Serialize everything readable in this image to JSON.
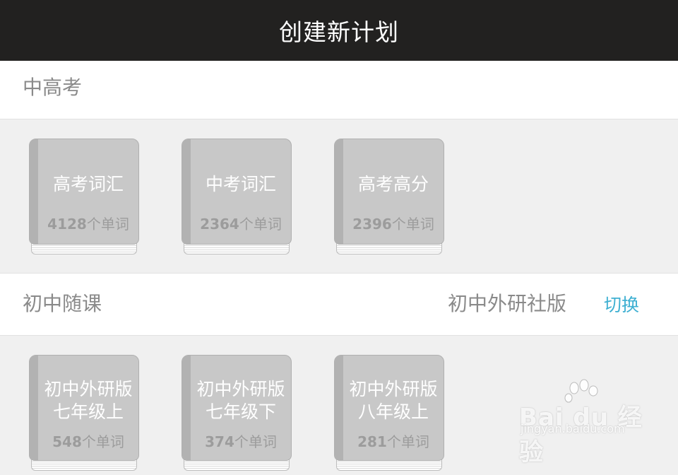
{
  "header": {
    "title": "创建新计划"
  },
  "sections": [
    {
      "label": "中高考",
      "books": [
        {
          "name_line1": "高考词汇",
          "count": "4128",
          "unit": "个单词"
        },
        {
          "name_line1": "中考词汇",
          "count": "2364",
          "unit": "个单词"
        },
        {
          "name_line1": "高考高分",
          "count": "2396",
          "unit": "个单词"
        }
      ]
    },
    {
      "label": "初中随课",
      "edition": "初中外研社版",
      "switch_label": "切换",
      "books": [
        {
          "name_line1": "初中外研版",
          "name_line2": "七年级上",
          "count": "548",
          "unit": "个单词"
        },
        {
          "name_line1": "初中外研版",
          "name_line2": "七年级下",
          "count": "374",
          "unit": "个单词"
        },
        {
          "name_line1": "初中外研版",
          "name_line2": "八年级上",
          "count": "281",
          "unit": "个单词"
        }
      ]
    }
  ],
  "watermark": {
    "brand": "Bai du 经验",
    "url": "jingyan.baidu.com"
  },
  "colors": {
    "topbar": "#222120",
    "accent": "#3fb0d2",
    "book_cover": "#c8c8c8"
  }
}
